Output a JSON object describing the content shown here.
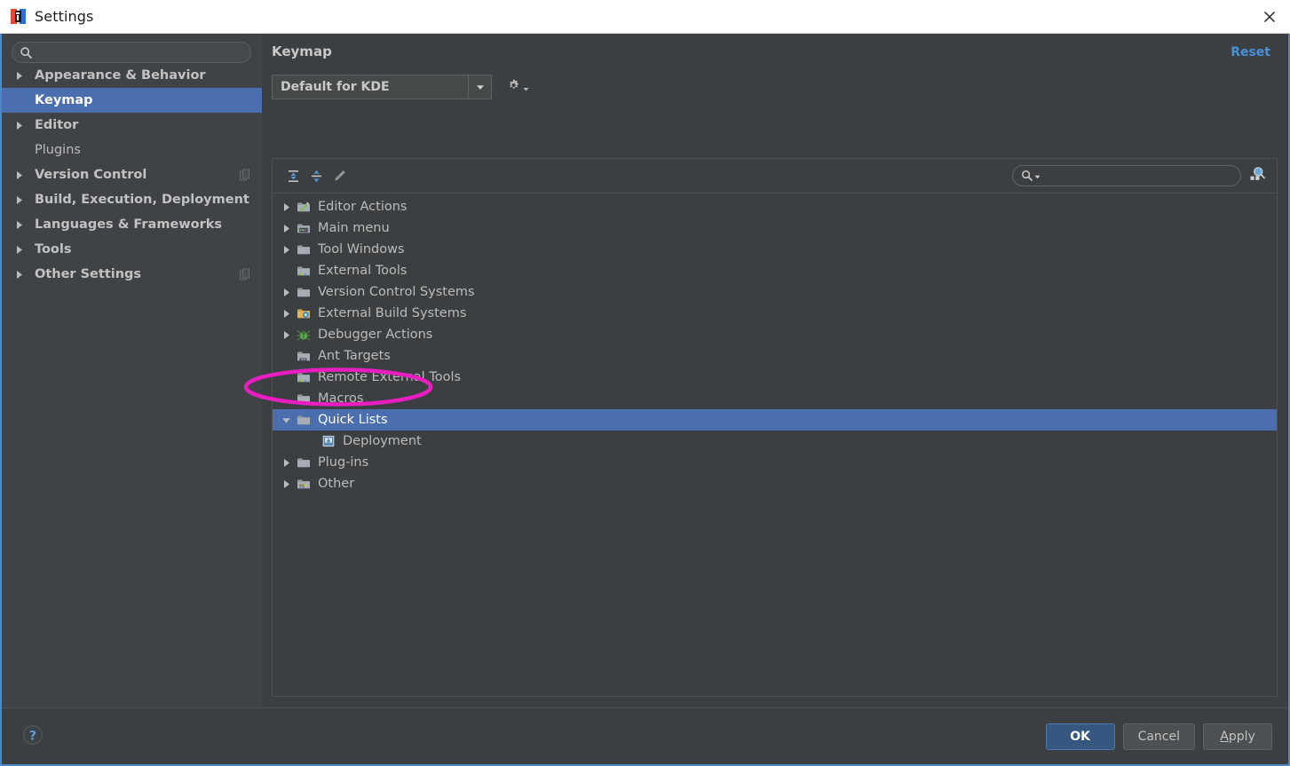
{
  "window": {
    "title": "Settings",
    "app_icon": "intellij-logo-icon",
    "close_icon": "close-icon"
  },
  "sidebar": {
    "search": {
      "value": "",
      "placeholder": "",
      "icon": "search-icon"
    },
    "items": [
      {
        "label": "Appearance & Behavior",
        "expandable": true,
        "bold": true,
        "selected": false,
        "badge": false
      },
      {
        "label": "Keymap",
        "expandable": false,
        "bold": true,
        "selected": true,
        "badge": false
      },
      {
        "label": "Editor",
        "expandable": true,
        "bold": true,
        "selected": false,
        "badge": false
      },
      {
        "label": "Plugins",
        "expandable": false,
        "bold": false,
        "selected": false,
        "badge": false
      },
      {
        "label": "Version Control",
        "expandable": true,
        "bold": true,
        "selected": false,
        "badge": true
      },
      {
        "label": "Build, Execution, Deployment",
        "expandable": true,
        "bold": true,
        "selected": false,
        "badge": false
      },
      {
        "label": "Languages & Frameworks",
        "expandable": true,
        "bold": true,
        "selected": false,
        "badge": false
      },
      {
        "label": "Tools",
        "expandable": true,
        "bold": true,
        "selected": false,
        "badge": false
      },
      {
        "label": "Other Settings",
        "expandable": true,
        "bold": true,
        "selected": false,
        "badge": true
      }
    ]
  },
  "main": {
    "title": "Keymap",
    "reset_label": "Reset",
    "scheme": {
      "value": "Default for KDE",
      "dropdown_icon": "chevron-down-icon",
      "gear_icon": "gear-icon"
    },
    "toolbar": {
      "expand_all_icon": "expand-all-icon",
      "collapse_all_icon": "collapse-all-icon",
      "edit_icon": "pencil-edit-icon",
      "find_placeholder": "",
      "find_value": "",
      "find_icon": "search-dropdown-icon",
      "find_shortcut_icon": "find-by-shortcut-icon"
    },
    "tree": [
      {
        "label": "Editor Actions",
        "depth": 0,
        "expandable": true,
        "expanded": false,
        "selected": false,
        "icon": "editor-actions-icon"
      },
      {
        "label": "Main menu",
        "depth": 0,
        "expandable": true,
        "expanded": false,
        "selected": false,
        "icon": "main-menu-icon"
      },
      {
        "label": "Tool Windows",
        "depth": 0,
        "expandable": true,
        "expanded": false,
        "selected": false,
        "icon": "folder-icon"
      },
      {
        "label": "External Tools",
        "depth": 0,
        "expandable": false,
        "expanded": false,
        "selected": false,
        "icon": "external-tools-icon"
      },
      {
        "label": "Version Control Systems",
        "depth": 0,
        "expandable": true,
        "expanded": false,
        "selected": false,
        "icon": "folder-icon"
      },
      {
        "label": "External Build Systems",
        "depth": 0,
        "expandable": true,
        "expanded": false,
        "selected": false,
        "icon": "build-systems-icon"
      },
      {
        "label": "Debugger Actions",
        "depth": 0,
        "expandable": true,
        "expanded": false,
        "selected": false,
        "icon": "debugger-bug-icon"
      },
      {
        "label": "Ant Targets",
        "depth": 0,
        "expandable": false,
        "expanded": false,
        "selected": false,
        "icon": "ant-targets-icon"
      },
      {
        "label": "Remote External Tools",
        "depth": 0,
        "expandable": false,
        "expanded": false,
        "selected": false,
        "icon": "external-tools-icon"
      },
      {
        "label": "Macros",
        "depth": 0,
        "expandable": false,
        "expanded": false,
        "selected": false,
        "icon": "folder-icon"
      },
      {
        "label": "Quick Lists",
        "depth": 0,
        "expandable": true,
        "expanded": true,
        "selected": true,
        "icon": "folder-icon"
      },
      {
        "label": "Deployment",
        "depth": 1,
        "expandable": false,
        "expanded": false,
        "selected": false,
        "icon": "deployment-icon"
      },
      {
        "label": "Plug-ins",
        "depth": 0,
        "expandable": true,
        "expanded": false,
        "selected": false,
        "icon": "folder-icon"
      },
      {
        "label": "Other",
        "depth": 0,
        "expandable": true,
        "expanded": false,
        "selected": false,
        "icon": "other-icon"
      }
    ]
  },
  "footer": {
    "help_icon": "help-question-icon",
    "buttons": [
      {
        "label": "OK",
        "primary": true,
        "mnemonic": ""
      },
      {
        "label": "Cancel",
        "primary": false,
        "mnemonic": ""
      },
      {
        "label": "Apply",
        "primary": false,
        "mnemonic": "A"
      }
    ]
  },
  "annotation": {
    "shape": "ellipse",
    "color": "#e81ec1",
    "targets": "Quick Lists"
  },
  "colors": {
    "accent_selection": "#4b6eaf",
    "panel_bg": "#3c3f41",
    "sidebar_bg": "#3f4246",
    "link": "#4a90d9",
    "annotation": "#e81ec1",
    "window_border": "#4a88c7"
  }
}
